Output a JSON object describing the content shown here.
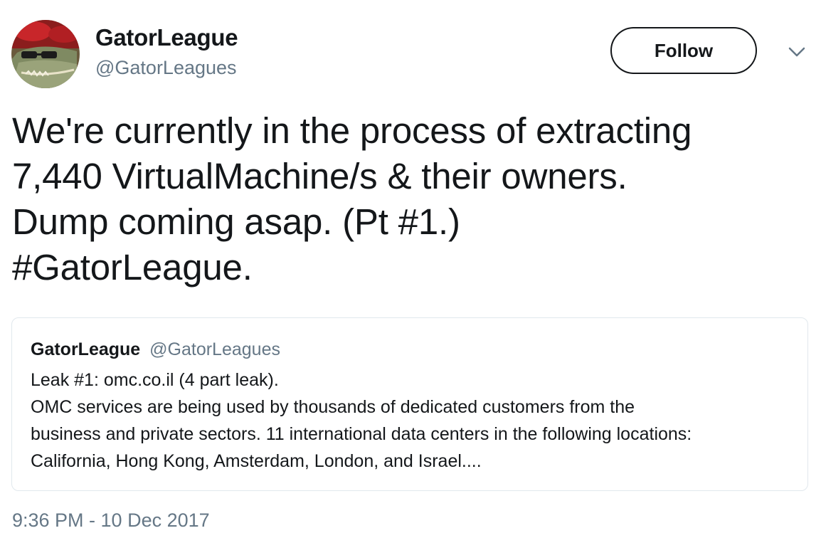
{
  "author": {
    "display_name": "GatorLeague",
    "handle": "@GatorLeagues",
    "avatar_icon": "alligator-avatar"
  },
  "actions": {
    "follow_label": "Follow",
    "menu_icon": "chevron-down-icon"
  },
  "tweet": {
    "lines": [
      "We're currently in the process of extracting",
      "7,440 VirtualMachine/s & their owners.",
      "Dump coming asap. (Pt #1.)",
      "#GatorLeague."
    ]
  },
  "quoted_tweet": {
    "display_name": "GatorLeague",
    "handle": "@GatorLeagues",
    "lines": [
      "Leak #1: omc.co.il (4 part leak).",
      "OMC services are being used by thousands of dedicated customers from the",
      "business and private sectors. 11 international data centers in the following locations:",
      "California, Hong Kong, Amsterdam, London, and Israel...."
    ]
  },
  "timestamp": "9:36 PM - 10 Dec 2017",
  "colors": {
    "text": "#14171a",
    "secondary": "#657786",
    "border": "#e1e8ed"
  }
}
